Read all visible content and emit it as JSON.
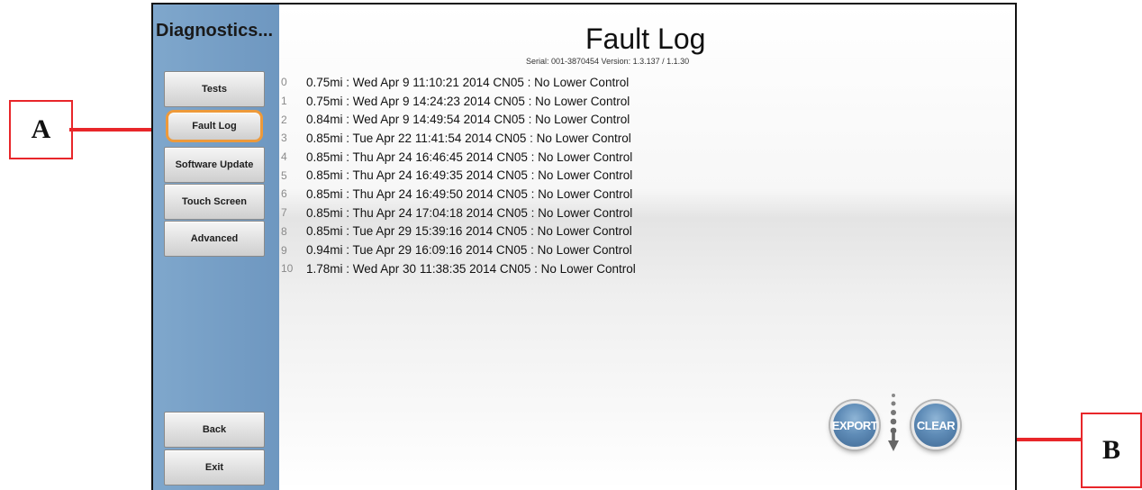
{
  "callouts": {
    "a": "A",
    "b": "B"
  },
  "sidebar": {
    "title": "Diagnostics...",
    "items": [
      {
        "label": "Tests"
      },
      {
        "label": "Fault Log"
      },
      {
        "label": "Software Update"
      },
      {
        "label": "Touch Screen"
      },
      {
        "label": "Advanced"
      }
    ],
    "back_label": "Back",
    "exit_label": "Exit"
  },
  "main": {
    "title": "Fault Log",
    "serial_line": "Serial: 001-3870454   Version: 1.3.137 / 1.1.30",
    "log": [
      {
        "index": "0",
        "entry": "0.75mi :  Wed Apr 9 11:10:21 2014  CN05 : No Lower Control"
      },
      {
        "index": "1",
        "entry": "0.75mi :  Wed Apr 9 14:24:23 2014  CN05 : No Lower Control"
      },
      {
        "index": "2",
        "entry": "0.84mi :  Wed Apr 9 14:49:54 2014  CN05 : No Lower Control"
      },
      {
        "index": "3",
        "entry": "0.85mi :  Tue Apr 22 11:41:54 2014  CN05 : No Lower Control"
      },
      {
        "index": "4",
        "entry": "0.85mi :  Thu Apr 24 16:46:45 2014  CN05 : No Lower Control"
      },
      {
        "index": "5",
        "entry": "0.85mi :  Thu Apr 24 16:49:35 2014  CN05 : No Lower Control"
      },
      {
        "index": "6",
        "entry": "0.85mi :  Thu Apr 24 16:49:50 2014  CN05 : No Lower Control"
      },
      {
        "index": "7",
        "entry": "0.85mi :  Thu Apr 24 17:04:18 2014  CN05 : No Lower Control"
      },
      {
        "index": "8",
        "entry": "0.85mi :  Tue Apr 29 15:39:16 2014  CN05 : No Lower Control"
      },
      {
        "index": "9",
        "entry": "0.94mi :  Tue Apr 29 16:09:16 2014  CN05 : No Lower Control"
      },
      {
        "index": "10",
        "entry": "1.78mi :  Wed Apr 30 11:38:35 2014  CN05 : No Lower Control"
      }
    ],
    "export_label": "EXPORT",
    "clear_label": "CLEAR"
  },
  "colors": {
    "sidebar": "#7fa7cc",
    "active_outline": "#ee9a3a",
    "callout": "#e8262a",
    "round_button": "#5f8cb7"
  },
  "icons": {
    "scroll": "dotted-down-arrow-icon"
  }
}
